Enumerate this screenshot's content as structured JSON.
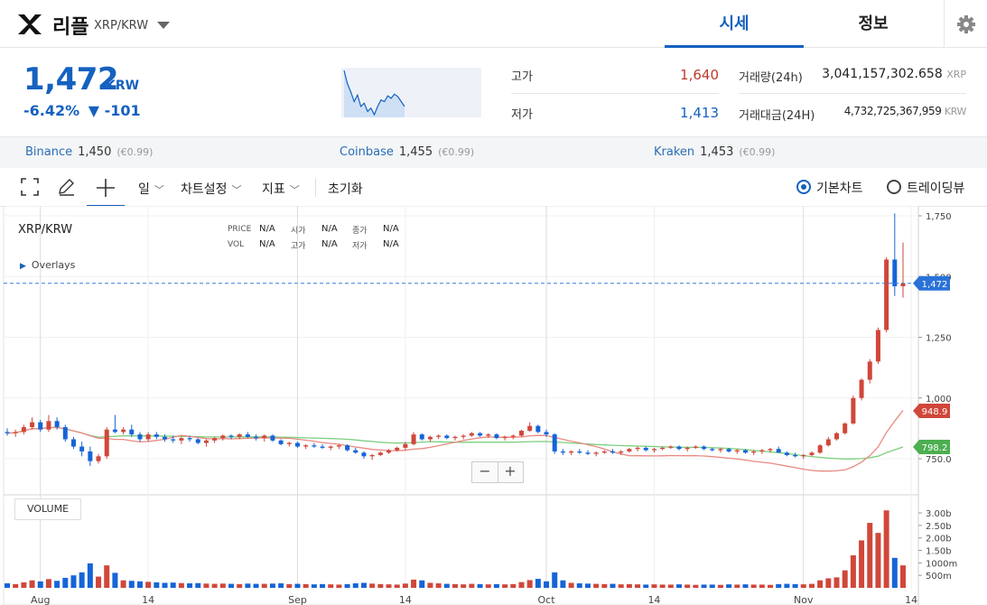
{
  "header": {
    "coin_name": "리플",
    "pair": "XRP/KRW",
    "tabs": [
      {
        "label": "시세",
        "active": true
      },
      {
        "label": "정보",
        "active": false
      }
    ],
    "accent_color": "#1561c0"
  },
  "ticker": {
    "price": "1,472",
    "unit": "KRW",
    "change_pct": "-6.42%",
    "change_arrow": "▼",
    "change_abs": "-101",
    "sparkline": [
      1690,
      1610,
      1560,
      1500,
      1540,
      1470,
      1490,
      1440,
      1460,
      1420,
      1470,
      1510,
      1500,
      1535,
      1520,
      1545,
      1530,
      1500,
      1470
    ],
    "high_label": "고가",
    "high_value": "1,640",
    "high_color": "#c0392b",
    "low_label": "저가",
    "low_value": "1,413",
    "low_color": "#1561c0",
    "vol_label": "거래량(24h)",
    "vol_value": "3,041,157,302.658",
    "vol_unit": "XRP",
    "amount_label": "거래대금(24H)",
    "amount_value": "4,732,725,367,959",
    "amount_unit": "KRW"
  },
  "exchanges": [
    {
      "name": "Binance",
      "price": "1,450",
      "eur": "(€0.99)"
    },
    {
      "name": "Coinbase",
      "price": "1,455",
      "eur": "(€0.99)"
    },
    {
      "name": "Kraken",
      "price": "1,453",
      "eur": "(€0.99)"
    }
  ],
  "toolbar": {
    "period": "일",
    "chart_settings": "차트설정",
    "indicators": "지표",
    "reset": "초기화",
    "basic_chart": "기본차트",
    "tradingview": "트레이딩뷰"
  },
  "chart_info": {
    "pair": "XRP/KRW",
    "overlays": "Overlays",
    "price_lbl": "PRICE",
    "vol_lbl": "VOL",
    "open_lbl": "시가",
    "high_lbl": "고가",
    "close_lbl": "종가",
    "low_lbl": "저가",
    "na": "N/A",
    "volume_label": "VOLUME",
    "zoom_minus": "−",
    "zoom_plus": "+"
  },
  "chart_data": {
    "type": "candlestick",
    "price_ticks": [
      750,
      1000,
      1250,
      1500,
      1750
    ],
    "price_tick_labels": [
      "750.0",
      "1,000",
      "1,250",
      "1,500",
      "1,750"
    ],
    "ylim": [
      690,
      1780
    ],
    "current_price": 1472,
    "current_price_label": "1,472",
    "ma_short_last": 948.9,
    "ma_short_label": "948.9",
    "ma_short_color": "#e88a82",
    "ma_long_last": 798.2,
    "ma_long_label": "798.2",
    "ma_long_color": "#7dce7d",
    "volume_ticks": [
      500,
      1000,
      1500,
      2000,
      2500,
      3000
    ],
    "volume_tick_labels": [
      "500m",
      "1000m",
      "1.50b",
      "2.00b",
      "2.50b",
      "3.00b"
    ],
    "volume_ylim": [
      0,
      3300
    ],
    "x_ticks": [
      {
        "label": "Aug",
        "i": 4,
        "major": true
      },
      {
        "label": "14",
        "i": 17,
        "major": false
      },
      {
        "label": "Sep",
        "i": 35,
        "major": true
      },
      {
        "label": "14",
        "i": 48,
        "major": false
      },
      {
        "label": "Oct",
        "i": 65,
        "major": true
      },
      {
        "label": "14",
        "i": 78,
        "major": false
      },
      {
        "label": "Nov",
        "i": 96,
        "major": true
      },
      {
        "label": "14",
        "i": 109,
        "major": false
      }
    ],
    "candles": [
      [
        860,
        875,
        845,
        855,
        180
      ],
      [
        855,
        870,
        840,
        860,
        150
      ],
      [
        860,
        890,
        850,
        880,
        220
      ],
      [
        880,
        920,
        870,
        900,
        300
      ],
      [
        900,
        910,
        860,
        870,
        260
      ],
      [
        870,
        930,
        860,
        905,
        350
      ],
      [
        905,
        920,
        870,
        880,
        280
      ],
      [
        880,
        890,
        820,
        830,
        400
      ],
      [
        830,
        840,
        790,
        800,
        500
      ],
      [
        800,
        820,
        760,
        780,
        620
      ],
      [
        780,
        800,
        720,
        740,
        980
      ],
      [
        740,
        770,
        730,
        760,
        450
      ],
      [
        760,
        880,
        750,
        870,
        900
      ],
      [
        870,
        930,
        855,
        860,
        600
      ],
      [
        860,
        880,
        850,
        870,
        300
      ],
      [
        870,
        890,
        840,
        850,
        280
      ],
      [
        850,
        860,
        820,
        830,
        260
      ],
      [
        830,
        860,
        820,
        850,
        240
      ],
      [
        850,
        860,
        830,
        840,
        220
      ],
      [
        840,
        850,
        820,
        830,
        200
      ],
      [
        830,
        845,
        815,
        825,
        210
      ],
      [
        825,
        840,
        810,
        835,
        190
      ],
      [
        835,
        845,
        820,
        830,
        180
      ],
      [
        830,
        835,
        810,
        815,
        190
      ],
      [
        815,
        830,
        800,
        825,
        170
      ],
      [
        825,
        840,
        815,
        835,
        160
      ],
      [
        835,
        850,
        825,
        845,
        170
      ],
      [
        845,
        850,
        830,
        840,
        160
      ],
      [
        840,
        855,
        830,
        850,
        150
      ],
      [
        850,
        860,
        835,
        840,
        170
      ],
      [
        840,
        850,
        825,
        835,
        160
      ],
      [
        835,
        850,
        820,
        845,
        160
      ],
      [
        845,
        850,
        820,
        825,
        170
      ],
      [
        825,
        830,
        805,
        810,
        180
      ],
      [
        810,
        820,
        800,
        815,
        150
      ],
      [
        815,
        820,
        795,
        800,
        160
      ],
      [
        800,
        810,
        790,
        805,
        150
      ],
      [
        805,
        815,
        795,
        800,
        140
      ],
      [
        800,
        810,
        790,
        795,
        150
      ],
      [
        795,
        805,
        785,
        800,
        140
      ],
      [
        800,
        810,
        790,
        805,
        130
      ],
      [
        805,
        810,
        780,
        785,
        150
      ],
      [
        785,
        795,
        770,
        775,
        180
      ],
      [
        775,
        780,
        750,
        760,
        200
      ],
      [
        760,
        770,
        745,
        765,
        170
      ],
      [
        765,
        780,
        760,
        775,
        150
      ],
      [
        775,
        790,
        770,
        785,
        140
      ],
      [
        785,
        800,
        780,
        795,
        130
      ],
      [
        795,
        820,
        785,
        810,
        170
      ],
      [
        810,
        860,
        805,
        850,
        330
      ],
      [
        850,
        855,
        825,
        830,
        300
      ],
      [
        830,
        845,
        820,
        840,
        200
      ],
      [
        840,
        850,
        830,
        845,
        180
      ],
      [
        845,
        850,
        830,
        835,
        160
      ],
      [
        835,
        845,
        825,
        840,
        150
      ],
      [
        840,
        850,
        830,
        845,
        140
      ],
      [
        845,
        860,
        840,
        855,
        160
      ],
      [
        855,
        860,
        840,
        845,
        150
      ],
      [
        845,
        855,
        835,
        850,
        140
      ],
      [
        850,
        855,
        830,
        835,
        150
      ],
      [
        835,
        845,
        825,
        840,
        140
      ],
      [
        840,
        850,
        830,
        845,
        150
      ],
      [
        845,
        870,
        840,
        865,
        230
      ],
      [
        865,
        900,
        860,
        885,
        310
      ],
      [
        885,
        890,
        855,
        860,
        360
      ],
      [
        860,
        870,
        840,
        850,
        260
      ],
      [
        850,
        855,
        770,
        780,
        620
      ],
      [
        780,
        790,
        765,
        775,
        300
      ],
      [
        775,
        785,
        765,
        780,
        200
      ],
      [
        780,
        790,
        770,
        775,
        180
      ],
      [
        775,
        785,
        765,
        770,
        170
      ],
      [
        770,
        780,
        760,
        775,
        160
      ],
      [
        775,
        785,
        770,
        780,
        150
      ],
      [
        780,
        790,
        770,
        775,
        160
      ],
      [
        775,
        785,
        765,
        780,
        140
      ],
      [
        780,
        795,
        775,
        790,
        150
      ],
      [
        790,
        800,
        780,
        795,
        140
      ],
      [
        795,
        800,
        780,
        785,
        130
      ],
      [
        785,
        795,
        775,
        790,
        140
      ],
      [
        790,
        800,
        785,
        795,
        130
      ],
      [
        795,
        805,
        790,
        800,
        130
      ],
      [
        800,
        805,
        785,
        790,
        140
      ],
      [
        790,
        800,
        780,
        795,
        130
      ],
      [
        795,
        805,
        790,
        800,
        120
      ],
      [
        800,
        805,
        785,
        790,
        130
      ],
      [
        790,
        795,
        780,
        785,
        130
      ],
      [
        785,
        795,
        775,
        790,
        120
      ],
      [
        790,
        795,
        775,
        780,
        140
      ],
      [
        780,
        790,
        770,
        785,
        130
      ],
      [
        785,
        790,
        770,
        775,
        140
      ],
      [
        775,
        785,
        765,
        780,
        130
      ],
      [
        780,
        790,
        770,
        785,
        130
      ],
      [
        785,
        795,
        775,
        790,
        120
      ],
      [
        790,
        800,
        780,
        775,
        150
      ],
      [
        775,
        780,
        760,
        765,
        160
      ],
      [
        765,
        775,
        755,
        760,
        150
      ],
      [
        760,
        770,
        750,
        765,
        140
      ],
      [
        765,
        780,
        760,
        775,
        160
      ],
      [
        775,
        810,
        770,
        805,
        300
      ],
      [
        805,
        840,
        800,
        830,
        380
      ],
      [
        830,
        860,
        825,
        855,
        420
      ],
      [
        855,
        900,
        850,
        895,
        700
      ],
      [
        895,
        1010,
        890,
        1000,
        1300
      ],
      [
        1000,
        1080,
        990,
        1075,
        1900
      ],
      [
        1075,
        1160,
        1060,
        1150,
        2600
      ],
      [
        1150,
        1290,
        1140,
        1280,
        2200
      ],
      [
        1280,
        1580,
        1270,
        1570,
        3100
      ],
      [
        1570,
        1760,
        1420,
        1460,
        1200
      ],
      [
        1460,
        1640,
        1413,
        1472,
        900
      ]
    ]
  }
}
